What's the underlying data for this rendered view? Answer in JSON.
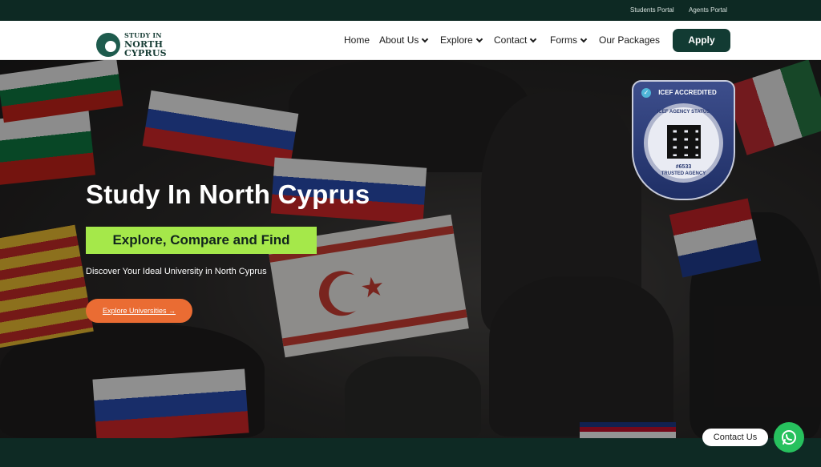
{
  "topbar": {
    "students_portal": "Students Portal",
    "agents_portal": "Agents Portal"
  },
  "logo": {
    "line1": "STUDY IN",
    "line2": "NORTH",
    "line3": "CYPRUS"
  },
  "nav": {
    "items": [
      {
        "label": "Home",
        "dropdown": false
      },
      {
        "label": "About Us",
        "dropdown": true
      },
      {
        "label": "Explore",
        "dropdown": true
      },
      {
        "label": "Contact",
        "dropdown": true
      },
      {
        "label": "Forms",
        "dropdown": true
      },
      {
        "label": "Our Packages",
        "dropdown": false
      }
    ],
    "apply_label": "Apply"
  },
  "hero": {
    "title": "Study In North Cyprus",
    "tagline": "Explore, Compare and Find",
    "subtitle": "Discover Your Ideal University in North Cyprus",
    "cta": "Explore Universities →"
  },
  "badge": {
    "header": "ICEF ACCREDITED",
    "ring_top": "ICEF AGENCY STATUS",
    "number": "#6533",
    "ring_bottom": "TRUSTED AGENCY"
  },
  "floating": {
    "contact_label": "Contact Us"
  },
  "colors": {
    "dark_green": "#0d2923",
    "accent_green": "#a5e84a",
    "cta_orange": "#ea6c33",
    "whatsapp": "#27c15e"
  }
}
